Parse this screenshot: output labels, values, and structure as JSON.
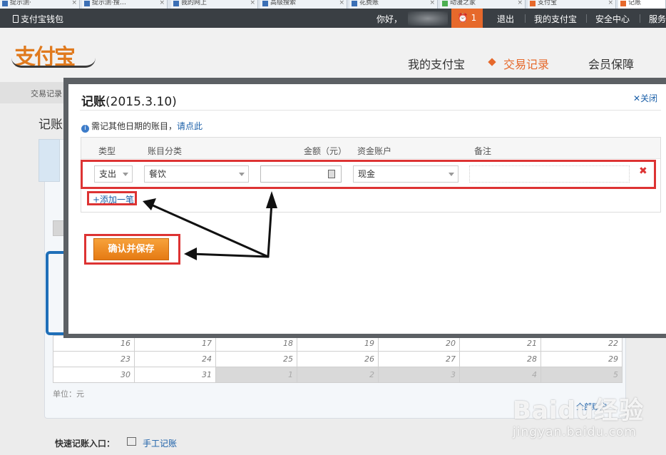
{
  "browser_tabs": [
    {
      "label": "提示测·"
    },
    {
      "label": "提示测·搜…"
    },
    {
      "label": "我的网上"
    },
    {
      "label": "高级搜索"
    },
    {
      "label": "花费账"
    },
    {
      "label": "动漫之家"
    },
    {
      "label": "支付宝"
    },
    {
      "label": "记账"
    }
  ],
  "topbar": {
    "wallet": "支付宝钱包",
    "greeting": "你好，",
    "alarm_count": "1",
    "logout": "退出",
    "my_alipay": "我的支付宝",
    "security": "安全中心",
    "service": "服务"
  },
  "header": {
    "logo": "支付宝",
    "nav": [
      "我的支付宝",
      "交易记录",
      "会员保障"
    ]
  },
  "subbar": {
    "crumb": "交易记录"
  },
  "page": {
    "heading": "记账",
    "unit": "单位：元",
    "quick_label": "快速记账入口：",
    "quick_link": "手工记账",
    "view_all": "全部账户"
  },
  "calendar": {
    "rows": [
      [
        "16",
        "17",
        "18",
        "19",
        "20",
        "21",
        "22"
      ],
      [
        "23",
        "24",
        "25",
        "26",
        "27",
        "28",
        "29"
      ],
      [
        "30",
        "31",
        "1",
        "2",
        "3",
        "4",
        "5"
      ]
    ]
  },
  "modal": {
    "title": "记账",
    "date": "(2015.3.10)",
    "close": "关闭",
    "info": "需记其他日期的账目，",
    "info_link": "请点此",
    "columns": [
      "类型",
      "账目分类",
      "金额（元）",
      "资金账户",
      "备注"
    ],
    "row": {
      "type": "支出",
      "category": "餐饮",
      "amount": "",
      "account": "现金",
      "note": ""
    },
    "add_more": "+添加一笔",
    "save": "确认并保存"
  },
  "watermark": {
    "brand": "Baidu经验",
    "url": "jingyan.baidu.com"
  },
  "colors": {
    "topbar": "#3a3f44",
    "accent": "#e6692b",
    "link": "#1a5fa8",
    "highlight": "#d33333"
  }
}
